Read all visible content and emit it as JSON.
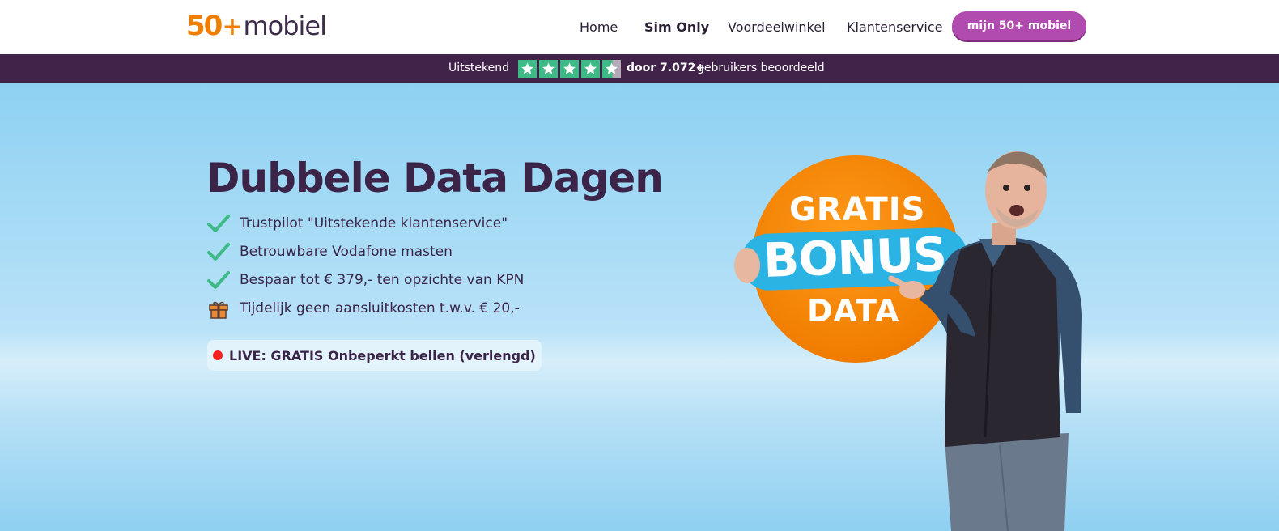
{
  "header": {
    "logo": {
      "number": "50",
      "plus": "+",
      "word": "mobiel"
    },
    "nav": [
      "Home",
      "Sim Only",
      "Voordeelwinkel",
      "Klantenservice"
    ],
    "account_button": "mijn 50+ mobiel"
  },
  "reviewbar": {
    "rating_label": "Uitstekend",
    "stars": 4.5,
    "count_text": "door 7.072+",
    "suffix": "gebruikers beoordeeld"
  },
  "hero": {
    "title": "Dubbele Data Dagen",
    "usps": [
      {
        "icon": "check-icon",
        "text": "Trustpilot \"Uitstekende klantenservice\""
      },
      {
        "icon": "check-icon",
        "text": "Betrouwbare Vodafone masten"
      },
      {
        "icon": "check-icon",
        "text": "Bespaar tot € 379,- ten opzichte van KPN"
      },
      {
        "icon": "gift-icon",
        "text": "Tijdelijk geen aansluitkosten t.w.v. € 20,-"
      }
    ],
    "live": "LIVE: GRATIS Onbeperkt bellen (verlengd)",
    "promo": {
      "line1": "GRATIS",
      "line2": "BONUS",
      "line3": "DATA"
    }
  },
  "colors": {
    "brand_orange": "#ef7d00",
    "brand_purple": "#41234a",
    "button_purple": "#b14bb0",
    "trustpilot_green": "#3dba86",
    "hero_blue": "#8ed1f2"
  }
}
